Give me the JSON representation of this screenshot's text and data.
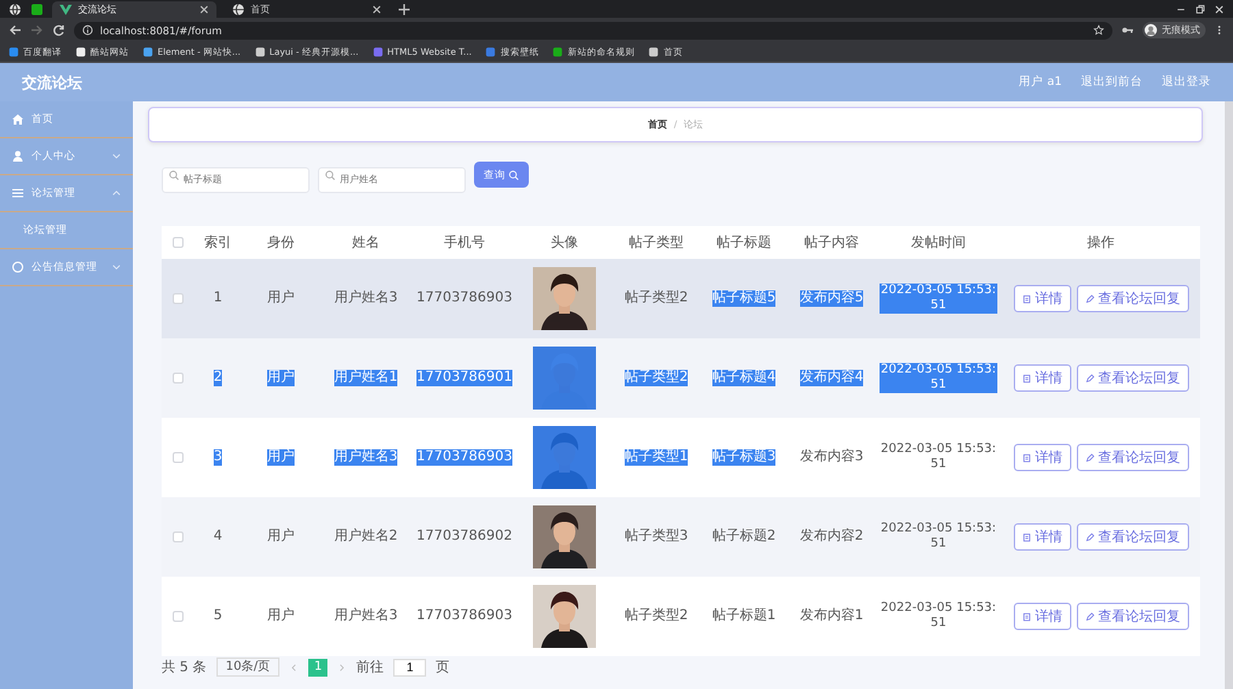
{
  "browser": {
    "tabs": [
      {
        "title": "交流论坛",
        "selected": true
      },
      {
        "title": "首页",
        "selected": false
      }
    ],
    "address": "localhost:8081/#/forum",
    "bookmarks": [
      "百度翻译",
      "酷站网站",
      "Element - 网站快...",
      "Layui - 经典开源模...",
      "HTML5 Website T...",
      "搜索壁纸",
      "新站的命名规则",
      "首页"
    ],
    "profile": "无痕模式"
  },
  "app": {
    "title": "交流论坛",
    "header_links": [
      "用户 a1",
      "退出到前台",
      "退出登录"
    ]
  },
  "sidebar": {
    "items": [
      {
        "label": "首页"
      },
      {
        "label": "个人中心",
        "expanded": false
      },
      {
        "label": "论坛管理",
        "expanded": true,
        "children": [
          {
            "label": "论坛管理"
          }
        ]
      },
      {
        "label": "公告信息管理",
        "expanded": false
      }
    ]
  },
  "breadcrumb": {
    "items": [
      "首页",
      "论坛"
    ],
    "separator": "/"
  },
  "search": {
    "fields": [
      {
        "placeholder": "帖子标题"
      },
      {
        "placeholder": "用户姓名"
      }
    ],
    "button": "查询"
  },
  "table": {
    "select_all": {
      "checked": false
    },
    "columns": [
      "索引",
      "身份",
      "姓名",
      "手机号",
      "头像",
      "帖子类型",
      "帖子标题",
      "帖子内容",
      "发帖时间",
      "操作"
    ],
    "rows": [
      {
        "checked": false,
        "hovered": true,
        "cells": [
          {
            "text": "1",
            "highlighted": false
          },
          {
            "text": "用户",
            "highlighted": false
          },
          {
            "text": "用户姓名3",
            "highlighted": false
          },
          {
            "text": "17703786903",
            "highlighted": false
          },
          {
            "kind": "picture",
            "highlighted": false
          },
          {
            "text": "帖子类型2",
            "highlighted": false
          },
          {
            "text": "帖子标题5",
            "highlighted": true
          },
          {
            "text": "发布内容5",
            "highlighted": true
          },
          {
            "text": "2022-03-05 15:53:51",
            "highlighted": true
          }
        ],
        "actions": [
          "详情",
          "查看论坛回复"
        ]
      },
      {
        "checked": false,
        "hovered": false,
        "cells": [
          {
            "text": "2",
            "highlighted": true
          },
          {
            "text": "用户",
            "highlighted": true
          },
          {
            "text": "用户姓名1",
            "highlighted": true
          },
          {
            "text": "17703786901",
            "highlighted": true
          },
          {
            "kind": "picture",
            "highlighted": true
          },
          {
            "text": "帖子类型2",
            "highlighted": true
          },
          {
            "text": "帖子标题4",
            "highlighted": true
          },
          {
            "text": "发布内容4",
            "highlighted": true
          },
          {
            "text": "2022-03-05 15:53:51",
            "highlighted": true
          }
        ],
        "actions": [
          "详情",
          "查看论坛回复"
        ]
      },
      {
        "checked": false,
        "hovered": false,
        "cells": [
          {
            "text": "3",
            "highlighted": true
          },
          {
            "text": "用户",
            "highlighted": true
          },
          {
            "text": "用户姓名3",
            "highlighted": true
          },
          {
            "text": "17703786903",
            "highlighted": true
          },
          {
            "kind": "picture",
            "highlighted": true
          },
          {
            "text": "帖子类型1",
            "highlighted": true
          },
          {
            "text": "帖子标题3",
            "highlighted": true
          },
          {
            "text": "发布内容3",
            "highlighted": false
          },
          {
            "text": "2022-03-05 15:53:51",
            "highlighted": false
          }
        ],
        "actions": [
          "详情",
          "查看论坛回复"
        ]
      },
      {
        "checked": false,
        "hovered": false,
        "cells": [
          {
            "text": "4",
            "highlighted": false
          },
          {
            "text": "用户",
            "highlighted": false
          },
          {
            "text": "用户姓名2",
            "highlighted": false
          },
          {
            "text": "17703786902",
            "highlighted": false
          },
          {
            "kind": "picture",
            "highlighted": false
          },
          {
            "text": "帖子类型3",
            "highlighted": false
          },
          {
            "text": "帖子标题2",
            "highlighted": false
          },
          {
            "text": "发布内容2",
            "highlighted": false
          },
          {
            "text": "2022-03-05 15:53:51",
            "highlighted": false
          }
        ],
        "actions": [
          "详情",
          "查看论坛回复"
        ]
      },
      {
        "checked": false,
        "hovered": false,
        "cells": [
          {
            "text": "5",
            "highlighted": false
          },
          {
            "text": "用户",
            "highlighted": false
          },
          {
            "text": "用户姓名3",
            "highlighted": false
          },
          {
            "text": "17703786903",
            "highlighted": false
          },
          {
            "kind": "picture",
            "highlighted": false
          },
          {
            "text": "帖子类型2",
            "highlighted": false
          },
          {
            "text": "帖子标题1",
            "highlighted": false
          },
          {
            "text": "发布内容1",
            "highlighted": false
          },
          {
            "text": "2022-03-05 15:53:51",
            "highlighted": false
          }
        ],
        "actions": [
          "详情",
          "查看论坛回复"
        ]
      }
    ]
  },
  "pagination": {
    "total": "共 5 条",
    "page_size": "10条/页",
    "pages": [
      {
        "label": "1",
        "selected": true
      }
    ],
    "goto_label": "前往",
    "goto_value": "1",
    "goto_suffix": "页"
  }
}
